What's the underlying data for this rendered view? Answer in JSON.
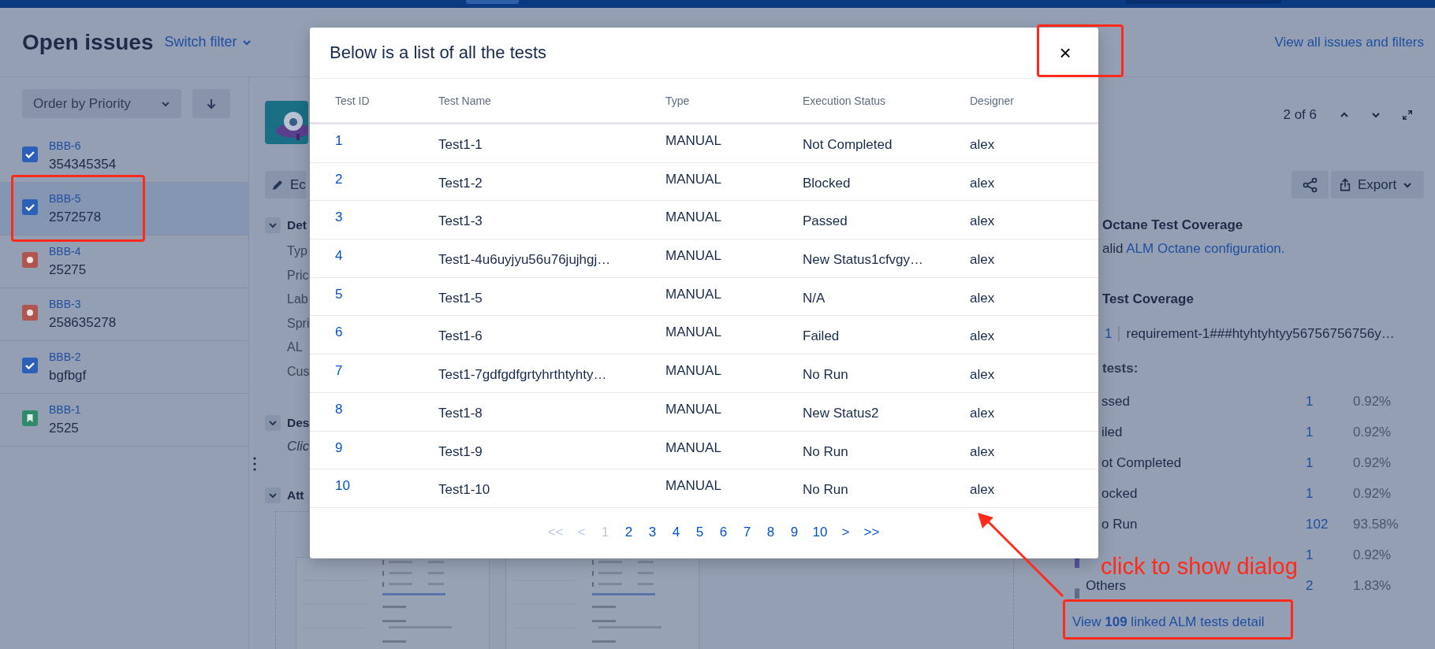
{
  "header": {
    "title": "Open issues",
    "switch_filter": "Switch filter",
    "view_all": "View all issues and filters"
  },
  "sidebar": {
    "order_by": "Order by Priority",
    "issues": [
      {
        "key": "BBB-6",
        "summary": "354345354",
        "kind": "task",
        "selected": false
      },
      {
        "key": "BBB-5",
        "summary": "2572578",
        "kind": "task",
        "selected": true
      },
      {
        "key": "BBB-4",
        "summary": "25275",
        "kind": "bug",
        "selected": false
      },
      {
        "key": "BBB-3",
        "summary": "258635278",
        "kind": "bug",
        "selected": false
      },
      {
        "key": "BBB-2",
        "summary": "bgfbgf",
        "kind": "task",
        "selected": false
      },
      {
        "key": "BBB-1",
        "summary": "2525",
        "kind": "story",
        "selected": false
      }
    ]
  },
  "detail": {
    "edit": "Ec",
    "details_heading": "Det",
    "fields": [
      "Typ",
      "Pric",
      "Lab",
      "Spri",
      "AL",
      "Cus"
    ],
    "description_heading": "Des",
    "description_placeholder": "Clic",
    "attachments_heading": "Att"
  },
  "right_panel": {
    "position": "2 of 6",
    "export": "Export",
    "octane_heading": "Octane Test Coverage",
    "octane_message": "alid",
    "octane_link": "ALM Octane configuration.",
    "coverage_heading": "Test Coverage",
    "requirement_count": "1",
    "requirement_name": "requirement-1###htyhtyhtyy56756756756y…",
    "tests_heading": "tests:",
    "stats": [
      {
        "label": "ssed",
        "count": "1",
        "percent": "0.92%"
      },
      {
        "label": "iled",
        "count": "1",
        "percent": "0.92%"
      },
      {
        "label": "ot Completed",
        "count": "1",
        "percent": "0.92%"
      },
      {
        "label": "ocked",
        "count": "1",
        "percent": "0.92%"
      },
      {
        "label": "o Run",
        "count": "102",
        "percent": "93.58%"
      },
      {
        "count": "1",
        "percent": "0.92%",
        "color": "#5b4fa3"
      },
      {
        "label": "Others",
        "count": "2",
        "percent": "1.83%",
        "color": "#5f6c88"
      }
    ],
    "link": "View **109** linked ALM tests detail"
  },
  "dialog": {
    "title": "Below is a list of all the tests",
    "close": "×",
    "columns": [
      "Test ID",
      "Test Name",
      "Type",
      "Execution Status",
      "Designer"
    ],
    "rows": [
      {
        "id": "1",
        "name": "Test1-1",
        "type": "MANUAL",
        "status": "Not Completed",
        "designer": "alex"
      },
      {
        "id": "2",
        "name": "Test1-2",
        "type": "MANUAL",
        "status": "Blocked",
        "designer": "alex"
      },
      {
        "id": "3",
        "name": "Test1-3",
        "type": "MANUAL",
        "status": "Passed",
        "designer": "alex"
      },
      {
        "id": "4",
        "name": "Test1-4u6uyjyu56u76jujhgj…",
        "type": "MANUAL",
        "status": "New Status1cfvgy…",
        "designer": "alex"
      },
      {
        "id": "5",
        "name": "Test1-5",
        "type": "MANUAL",
        "status": "N/A",
        "designer": "alex"
      },
      {
        "id": "6",
        "name": "Test1-6",
        "type": "MANUAL",
        "status": "Failed",
        "designer": "alex"
      },
      {
        "id": "7",
        "name": "Test1-7gdfgdfgrtyhrthtyhty…",
        "type": "MANUAL",
        "status": "No Run",
        "designer": "alex"
      },
      {
        "id": "8",
        "name": "Test1-8",
        "type": "MANUAL",
        "status": "New Status2",
        "designer": "alex"
      },
      {
        "id": "9",
        "name": "Test1-9",
        "type": "MANUAL",
        "status": "No Run",
        "designer": "alex"
      },
      {
        "id": "10",
        "name": "Test1-10",
        "type": "MANUAL",
        "status": "No Run",
        "designer": "alex"
      }
    ],
    "pagination": [
      {
        "label": "<<",
        "selected": false,
        "disabled": true
      },
      {
        "label": "<",
        "selected": false,
        "disabled": true
      },
      {
        "label": "1",
        "selected": true,
        "disabled": false
      },
      {
        "label": "2",
        "selected": false,
        "disabled": false
      },
      {
        "label": "3",
        "selected": false,
        "disabled": false
      },
      {
        "label": "4",
        "selected": false,
        "disabled": false
      },
      {
        "label": "5",
        "selected": false,
        "disabled": false
      },
      {
        "label": "6",
        "selected": false,
        "disabled": false
      },
      {
        "label": "7",
        "selected": false,
        "disabled": false
      },
      {
        "label": "8",
        "selected": false,
        "disabled": false
      },
      {
        "label": "9",
        "selected": false,
        "disabled": false
      },
      {
        "label": "10",
        "selected": false,
        "disabled": false
      },
      {
        "label": ">",
        "selected": false,
        "disabled": false
      },
      {
        "label": ">>",
        "selected": false,
        "disabled": false
      }
    ]
  },
  "annotation": {
    "text": "click to show dialog"
  }
}
